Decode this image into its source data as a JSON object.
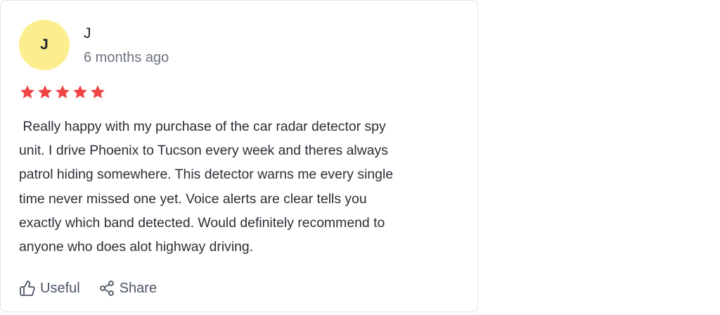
{
  "review": {
    "author": {
      "initial": "J",
      "name": "J",
      "avatar_color": "#fcee8f"
    },
    "date": "6 months ago",
    "rating": {
      "value": 5,
      "max": 5,
      "star_color": "#ef4444"
    },
    "text": " Really happy with my purchase of the car radar detector spy\nunit. I drive Phoenix to Tucson every week and theres always\npatrol hiding somewhere. This detector warns me every single\ntime never missed one yet. Voice alerts are clear tells you\nexactly which band detected. Would definitely recommend to\nanyone who does alot highway driving.",
    "actions": {
      "useful_label": "Useful",
      "useful_icon": "thumbs-up-icon",
      "share_label": "Share",
      "share_icon": "share-icon"
    }
  }
}
